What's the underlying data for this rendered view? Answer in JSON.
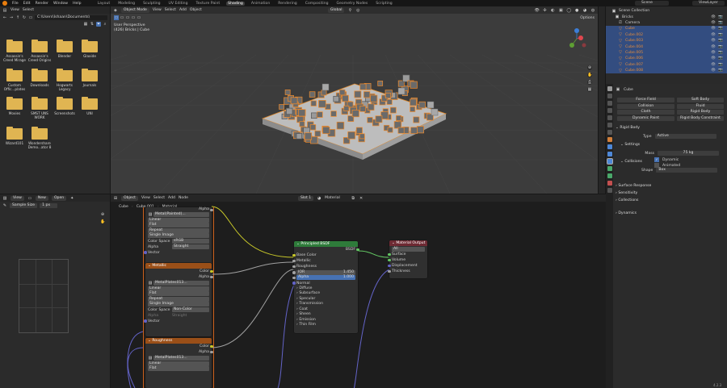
{
  "menu": [
    "File",
    "Edit",
    "Render",
    "Window",
    "Help"
  ],
  "workspaces": [
    "Layout",
    "Modeling",
    "Sculpting",
    "UV Editing",
    "Texture Paint",
    "Shading",
    "Animation",
    "Rendering",
    "Compositing",
    "Geometry Nodes",
    "Scripting"
  ],
  "scene": {
    "label": "Scene",
    "view_layer": "ViewLayer"
  },
  "file_browser": {
    "view": "View",
    "select": "Select",
    "path": "C:\\Users\\Ishaan\\Documents\\",
    "folders": [
      "Assassin's Creed Mirage",
      "Assassin's Creed Origins",
      "Blender",
      "Glaxide",
      "Custom Offic...plates",
      "Downloads",
      "Hogwarts Legacy",
      "Journals",
      "Movies",
      "SMST UNS WORK",
      "Screenshots",
      "UNI",
      "Wizard101",
      "Wondershare Demo...ator 8"
    ]
  },
  "viewport": {
    "mode": "Object Mode",
    "view": "View",
    "select": "Select",
    "add": "Add",
    "object": "Object",
    "transform": "Global",
    "options": "Options",
    "line1": "User Perspective",
    "line2": "(426) Bricks | Cube"
  },
  "outliner": {
    "items": [
      {
        "label": "Scene Collection",
        "kind": "collection"
      },
      {
        "label": "Bricks",
        "kind": "collection"
      },
      {
        "label": "Camera",
        "kind": "camera"
      },
      {
        "label": "Cube",
        "kind": "object",
        "selected": true
      },
      {
        "label": "Cube.002",
        "kind": "object",
        "selected": true
      },
      {
        "label": "Cube.003",
        "kind": "object",
        "selected": true
      },
      {
        "label": "Cube.004",
        "kind": "object",
        "selected": true
      },
      {
        "label": "Cube.005",
        "kind": "object",
        "selected": true
      },
      {
        "label": "Cube.006",
        "kind": "object",
        "selected": true
      },
      {
        "label": "Cube.007",
        "kind": "object",
        "selected": true
      },
      {
        "label": "Cube.008",
        "kind": "object",
        "selected": true
      }
    ]
  },
  "properties": {
    "object": "Cube",
    "physics_buttons": [
      "Force Field",
      "Soft Body",
      "Collision",
      "Fluid",
      "Cloth",
      "Rigid Body",
      "Dynamic Paint",
      "Rigid Body Constraint"
    ],
    "rigid_body": "Rigid Body",
    "type_label": "Type",
    "type_value": "Active",
    "settings": "Settings",
    "mass_label": "Mass",
    "mass_value": "75 kg",
    "dynamic": "Dynamic",
    "animated": "Animated",
    "collisions": "Collisions",
    "shape_label": "Shape",
    "shape_value": "Box",
    "sections": [
      "Surface Response",
      "Sensitivity",
      "Collections",
      "Dynamics"
    ]
  },
  "image_editor": {
    "view": "View",
    "new": "New",
    "open": "Open",
    "sample": "Sample Size",
    "sample_val": "1 px"
  },
  "node_editor": {
    "object": "Object",
    "view": "View",
    "select": "Select",
    "add": "Add",
    "node": "Node",
    "slot": "Slot 1",
    "material": "Material",
    "breadcrumb": [
      "Cube",
      "Cube.001",
      "Material"
    ],
    "tex_top": {
      "file": "Metal(Painted)...",
      "opts": [
        "Linear",
        "Flat",
        "Repeat",
        "Single Image"
      ],
      "cs_label": "Color Space",
      "cs_val": "sRGB",
      "alpha_label": "Alpha",
      "alpha_val": "Straight",
      "vector": "Vector",
      "out_alpha": "Alpha"
    },
    "metallic": {
      "title": "Metallic",
      "out_color": "Color",
      "out_alpha": "Alpha",
      "file": "MetalPlates013...",
      "opts": [
        "Linear",
        "Flat",
        "Repeat",
        "Single Image"
      ],
      "cs_label": "Color Space",
      "cs_val": "Non-Color",
      "alpha_label": "Alpha",
      "alpha_val": "Straight",
      "vector": "Vector"
    },
    "roughness": {
      "title": "Roughness",
      "out_color": "Color",
      "out_alpha": "Alpha",
      "file": "MetalPlates013...",
      "opts": [
        "Linear",
        "Flat"
      ]
    },
    "bsdf": {
      "title": "Principled BSDF",
      "out": "BSDF",
      "inputs": [
        "Base Color",
        "Metallic",
        "Roughness"
      ],
      "ior_label": "IOR",
      "ior_val": "1.450",
      "alpha_label": "Alpha",
      "alpha_val": "1.000",
      "normal": "Normal",
      "subpanels": [
        "Diffuse",
        "Subsurface",
        "Specular",
        "Transmission",
        "Coat",
        "Sheen",
        "Emission",
        "Thin Film"
      ]
    },
    "output": {
      "title": "Material Output",
      "target": "All",
      "inputs": [
        "Surface",
        "Volume",
        "Displacement",
        "Thickness"
      ]
    }
  },
  "version": "4.2.3"
}
